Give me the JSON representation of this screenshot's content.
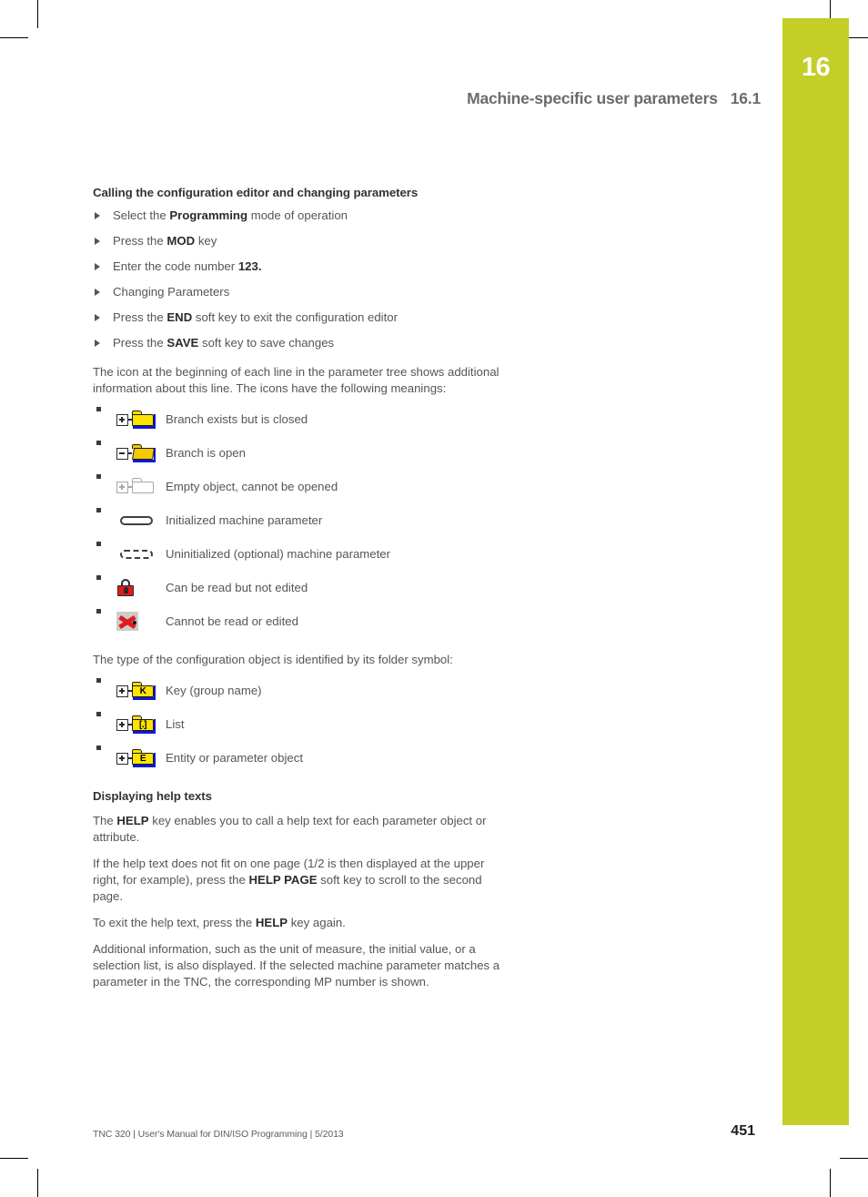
{
  "page": {
    "chapter_number": "16",
    "running_head_title": "Machine-specific user parameters",
    "running_head_section": "16.1",
    "page_number": "451",
    "footer": "TNC 320 | User's Manual for DIN/ISO Programming | 5/2013",
    "accent_color": "#c3ce26"
  },
  "section_calling": {
    "heading": "Calling the configuration editor and changing parameters",
    "steps": [
      {
        "pre": "Select the ",
        "strong": "Programming",
        "post": " mode of operation"
      },
      {
        "pre": "Press the ",
        "strong": "MOD",
        "post": " key"
      },
      {
        "pre": "Enter the code number ",
        "strong": "123.",
        "post": ""
      },
      {
        "pre": "Changing Parameters",
        "strong": "",
        "post": ""
      },
      {
        "pre": "Press the ",
        "strong": "END",
        "post": " soft key to exit the configuration editor"
      },
      {
        "pre": "Press the ",
        "strong": "SAVE",
        "post": " soft key to save changes"
      }
    ]
  },
  "icon_intro": "The icon at the beginning of each line in the parameter tree shows additional information about this line. The icons have the following meanings:",
  "icon_legend": [
    {
      "icon": "folder-closed-icon",
      "label": "Branch exists but is closed"
    },
    {
      "icon": "folder-open-icon",
      "label": "Branch is open"
    },
    {
      "icon": "folder-empty-icon",
      "label": "Empty object, cannot be opened"
    },
    {
      "icon": "parameter-initialized-icon",
      "label": "Initialized machine parameter"
    },
    {
      "icon": "parameter-uninitialized-icon",
      "label": "Uninitialized (optional) machine parameter"
    },
    {
      "icon": "lock-icon",
      "label": "Can be read but not edited"
    },
    {
      "icon": "no-access-icon",
      "label": "Cannot be read or edited"
    }
  ],
  "folder_intro": "The type of the configuration object is identified by its folder symbol:",
  "folder_legend": [
    {
      "icon": "folder-key-icon",
      "glyph": "K",
      "label": "Key (group name)"
    },
    {
      "icon": "folder-list-icon",
      "glyph": "[.]",
      "label": "List"
    },
    {
      "icon": "folder-entity-icon",
      "glyph": "E",
      "label": "Entity or parameter object"
    }
  ],
  "section_help": {
    "heading": "Displaying help texts",
    "paragraphs": [
      {
        "p1": "The ",
        "s1": "HELP",
        "p2": " key enables you to call a help text for each parameter object or attribute.",
        "s2": "",
        "p3": ""
      },
      {
        "p1": "If the help text does not fit on one page (1/2 is then displayed at the upper right, for example), press the ",
        "s1": "HELP PAGE",
        "p2": " soft key to scroll to the second page.",
        "s2": "",
        "p3": ""
      },
      {
        "p1": "To exit the help text, press the ",
        "s1": "HELP",
        "p2": " key again.",
        "s2": "",
        "p3": ""
      },
      {
        "p1": "Additional information, such as the unit of measure, the initial value, or a selection list, is also displayed. If the selected machine parameter matches a parameter in the TNC, the corresponding MP number is shown.",
        "s1": "",
        "p2": "",
        "s2": "",
        "p3": ""
      }
    ]
  }
}
